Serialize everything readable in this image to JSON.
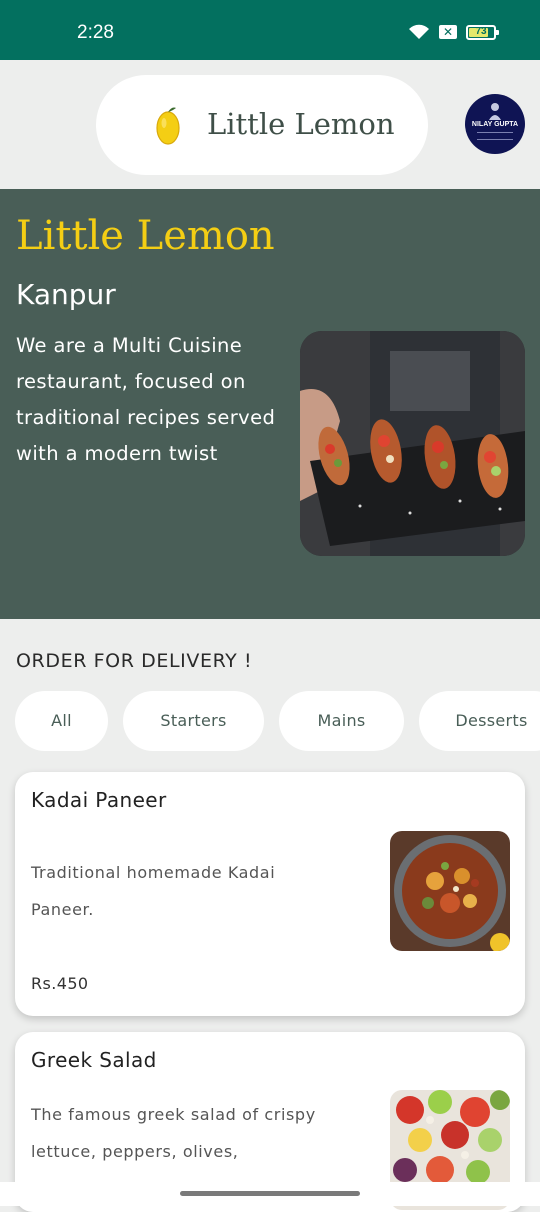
{
  "status_bar": {
    "time": "2:28",
    "battery": "73",
    "icons": [
      "wifi-icon",
      "close-box-icon",
      "battery-icon"
    ]
  },
  "header": {
    "brand": "Little Lemon",
    "logo_icon": "lemon-icon",
    "avatar": {
      "name": "NILAY GUPTA"
    }
  },
  "hero": {
    "title": "Little Lemon",
    "city": "Kanpur",
    "description": "We are a Multi Cuisine restaurant, focused on traditional recipes served with a modern twist"
  },
  "delivery": {
    "title": "ORDER FOR DELIVERY !",
    "categories": [
      "All",
      "Starters",
      "Mains",
      "Desserts"
    ]
  },
  "menu": [
    {
      "name": "Kadai Paneer",
      "description": "Traditional homemade Kadai Paneer.",
      "price": "Rs.450"
    },
    {
      "name": "Greek Salad",
      "description": "The famous greek salad of crispy lettuce, peppers, olives,"
    }
  ],
  "colors": {
    "status_bar": "#03705f",
    "hero_bg": "#495e57",
    "accent_yellow": "#f4ce14",
    "page_bg": "#edeeed"
  }
}
